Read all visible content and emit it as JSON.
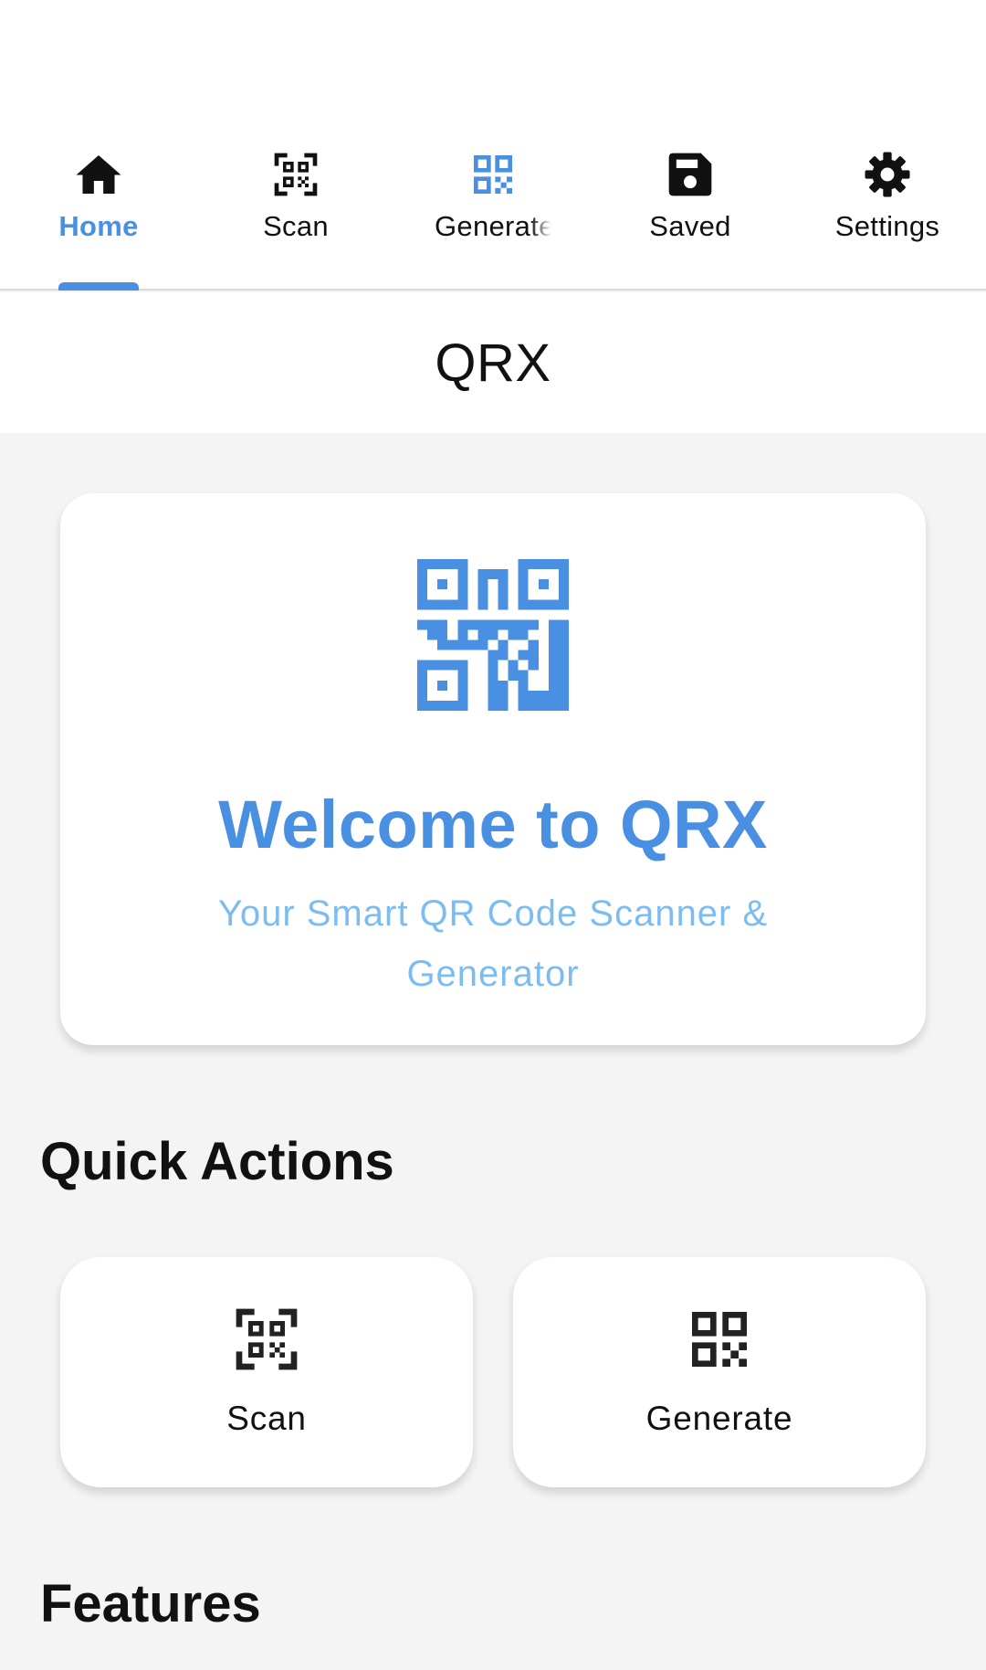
{
  "tabs": {
    "home": {
      "label": "Home",
      "icon": "home-icon"
    },
    "scan": {
      "label": "Scan",
      "icon": "qr-scan-icon"
    },
    "generate": {
      "label": "Generate",
      "icon": "qr-code-icon"
    },
    "saved": {
      "label": "Saved",
      "icon": "save-icon"
    },
    "settings": {
      "label": "Settings",
      "icon": "gear-icon"
    },
    "active": "home"
  },
  "header": {
    "title": "QRX"
  },
  "welcome": {
    "icon": "qr-code-logo-icon",
    "title": "Welcome to QRX",
    "subtitle": "Your Smart QR Code Scanner & Generator"
  },
  "quick_actions": {
    "title": "Quick Actions",
    "scan_label": "Scan",
    "generate_label": "Generate"
  },
  "features": {
    "title": "Features"
  },
  "colors": {
    "accent": "#4a90e2",
    "accent_light": "#7cbcf0",
    "text": "#111111",
    "background": "#f4f4f4"
  }
}
